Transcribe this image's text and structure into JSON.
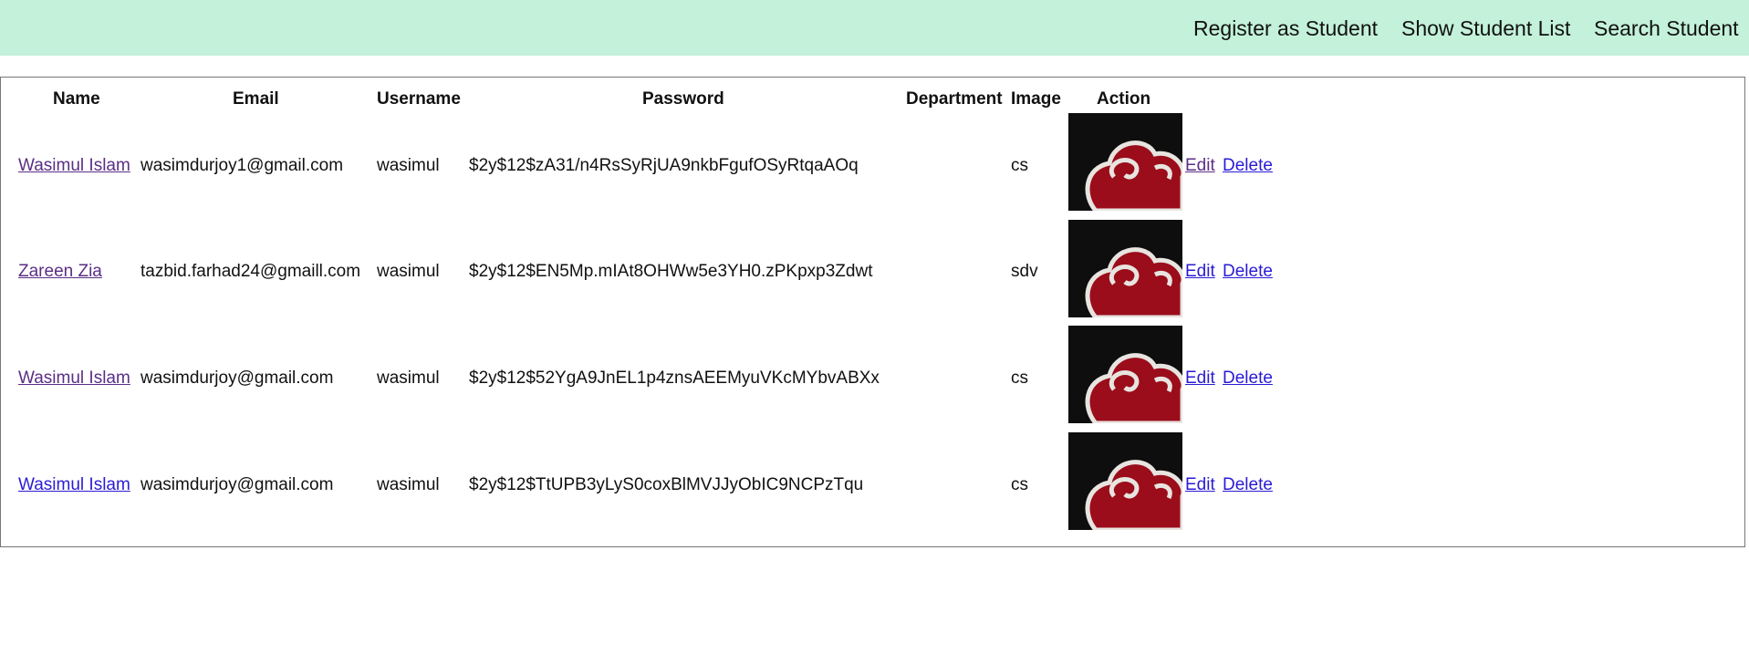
{
  "nav": {
    "register_label": "Register as Student",
    "list_label": "Show Student List",
    "search_label": "Search Student"
  },
  "table": {
    "headers": [
      "Name",
      "Email",
      "Username",
      "Password",
      "Department",
      "Image",
      "Action"
    ],
    "rows": [
      {
        "name": "Wasimul Islam",
        "email": "wasimdurjoy1@gmail.com",
        "username": "wasimul",
        "password": "$2y$12$zA31/n4RsSyRjUA9nkbFgufOSyRtqaAOq",
        "department": "cs",
        "edit": "Edit",
        "delete": "Delete"
      },
      {
        "name": "Zareen Zia",
        "email": "tazbid.farhad24@gmaill.com",
        "username": "wasimul",
        "password": "$2y$12$EN5Mp.mIAt8OHWw5e3YH0.zPKpxp3Zdwt",
        "department": "sdv",
        "edit": "Edit",
        "delete": "Delete"
      },
      {
        "name": "Wasimul Islam",
        "email": "wasimdurjoy@gmail.com",
        "username": "wasimul",
        "password": "$2y$12$52YgA9JnEL1p4znsAEEMyuVKcMYbvABXx",
        "department": "cs",
        "edit": "Edit",
        "delete": "Delete"
      },
      {
        "name": "Wasimul Islam",
        "email": "wasimdurjoy@gmail.com",
        "username": "wasimul",
        "password": "$2y$12$TtUPB3yLyS0coxBlMVJJyObIC9NCPzTqu",
        "department": "cs",
        "edit": "Edit",
        "delete": "Delete"
      }
    ]
  },
  "colors": {
    "nav_bg": "#c3f1da",
    "link": "#2a1bd4",
    "visited_link": "#5b2e86",
    "cloud_red": "#9b0d1b"
  },
  "image_icon": "red-cloud-icon"
}
